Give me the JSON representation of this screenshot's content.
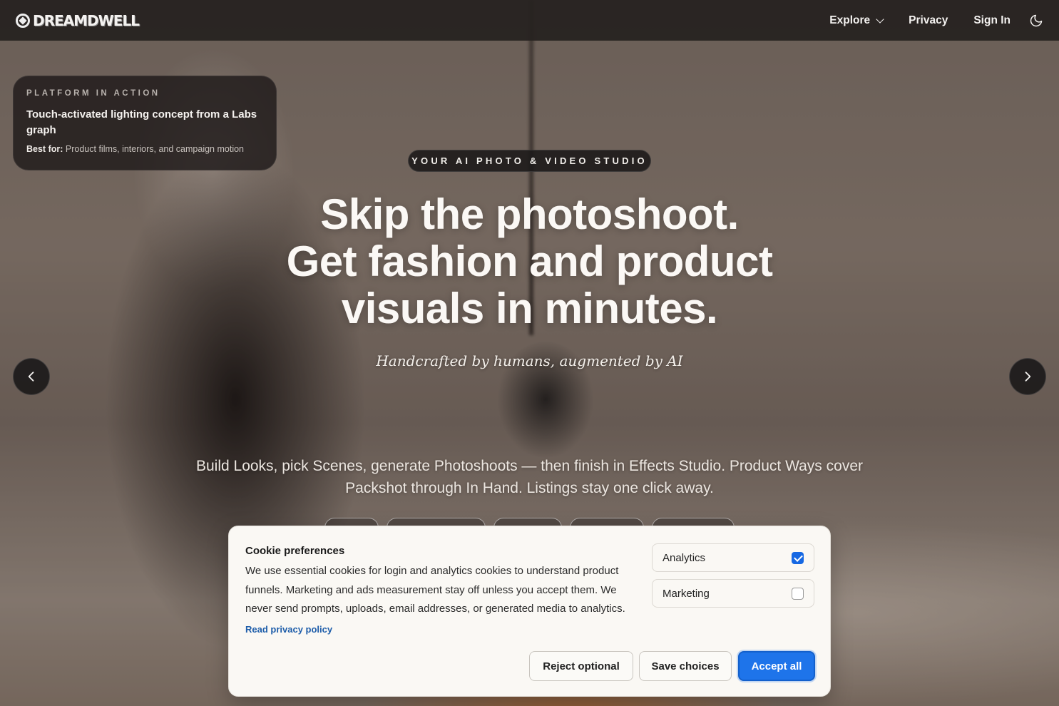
{
  "nav": {
    "logo_text": "DREAMDWELL",
    "explore_label": "Explore",
    "privacy_label": "Privacy",
    "signin_label": "Sign In"
  },
  "info_card": {
    "eyebrow": "PLATFORM IN ACTION",
    "title": "Touch-activated lighting concept from a Labs graph",
    "best_for_label": "Best for:",
    "best_for_value": "Product films, interiors, and campaign motion"
  },
  "hero": {
    "eyebrow": "YOUR AI PHOTO & VIDEO STUDIO",
    "headline_lines": [
      "Skip the photoshoot.",
      "Get fashion and product",
      "visuals in minutes."
    ],
    "tagline": "Handcrafted by humans, augmented by AI",
    "subcopy": "Build Looks, pick Scenes, generate Photoshoots — then finish in Effects Studio. Product Ways cover Packshot through In Hand. Listings stay one click away."
  },
  "cookie": {
    "title": "Cookie preferences",
    "text": "We use essential cookies for login and analytics cookies to understand product funnels. Marketing and ads measurement stay off unless you accept them. We never send prompts, uploads, email addresses, or generated media to analytics.",
    "link": "Read privacy policy",
    "options": [
      {
        "label": "Analytics",
        "checked": true
      },
      {
        "label": "Marketing",
        "checked": false
      }
    ],
    "reject_label": "Reject optional",
    "save_label": "Save choices",
    "accept_label": "Accept all"
  },
  "colors": {
    "accent": "#1e74ea",
    "link": "#1f5eaa",
    "nav_bg": "#262220"
  },
  "icons": [
    "logo-mark-icon",
    "chevron-down-icon",
    "moon-icon",
    "chevron-left-icon",
    "chevron-right-icon"
  ]
}
